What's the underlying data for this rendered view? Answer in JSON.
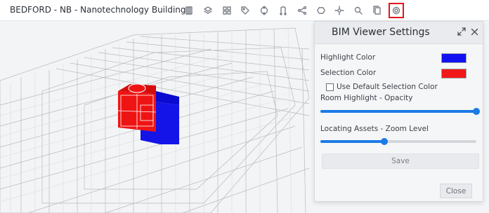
{
  "app": {
    "title": "BEDFORD - NB - Nanotechnology Building"
  },
  "toolbar": {
    "tools": [
      {
        "name": "model-browser-icon",
        "active": false
      },
      {
        "name": "layers-icon",
        "active": false
      },
      {
        "name": "grid-icon",
        "active": false
      },
      {
        "name": "tag-icon",
        "active": false
      },
      {
        "name": "sync-icon",
        "active": false
      },
      {
        "name": "route-icon",
        "active": false
      },
      {
        "name": "share-icon",
        "active": false
      },
      {
        "name": "assets-icon",
        "active": false
      },
      {
        "name": "navigate-icon",
        "active": false
      },
      {
        "name": "search-icon",
        "active": false
      },
      {
        "name": "documents-icon",
        "active": false
      },
      {
        "name": "settings-icon",
        "active": true
      }
    ]
  },
  "settings": {
    "title": "BIM Viewer Settings",
    "highlight_color_label": "Highlight Color",
    "highlight_color": "#1010f0",
    "selection_color_label": "Selection Color",
    "selection_color": "#f01818",
    "use_default_label": "Use Default Selection Color",
    "use_default_checked": false,
    "room_opacity_label": "Room Highlight - Opacity",
    "room_opacity_value": 1.0,
    "zoom_level_label": "Locating Assets - Zoom Level",
    "zoom_level_value": 0.41,
    "save_label": "Save",
    "close_label": "Close"
  }
}
